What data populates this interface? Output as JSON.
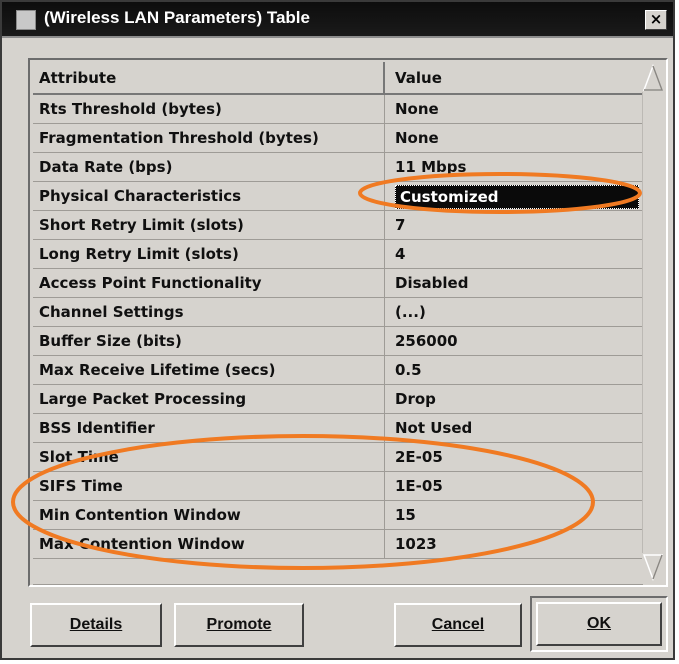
{
  "window": {
    "title": "(Wireless LAN Parameters) Table",
    "close_glyph": "×"
  },
  "table": {
    "columns": [
      "Attribute",
      "Value"
    ],
    "rows": [
      {
        "attribute": "Rts Threshold (bytes)",
        "value": "None"
      },
      {
        "attribute": "Fragmentation Threshold (bytes)",
        "value": "None"
      },
      {
        "attribute": "Data Rate (bps)",
        "value": "11 Mbps"
      },
      {
        "attribute": "Physical Characteristics",
        "value": "Customized",
        "selected": true
      },
      {
        "attribute": "Short Retry Limit (slots)",
        "value": "7"
      },
      {
        "attribute": "Long Retry Limit (slots)",
        "value": "4"
      },
      {
        "attribute": "Access Point Functionality",
        "value": "Disabled"
      },
      {
        "attribute": "Channel Settings",
        "value": "(...)"
      },
      {
        "attribute": "Buffer Size (bits)",
        "value": "256000"
      },
      {
        "attribute": "Max Receive Lifetime (secs)",
        "value": "0.5"
      },
      {
        "attribute": "Large Packet Processing",
        "value": "Drop"
      },
      {
        "attribute": "BSS Identifier",
        "value": "Not Used"
      },
      {
        "attribute": "Slot Time",
        "value": "2E-05"
      },
      {
        "attribute": "SIFS Time",
        "value": "1E-05"
      },
      {
        "attribute": "Min Contention Window",
        "value": "15"
      },
      {
        "attribute": "Max Contention Window",
        "value": "1023"
      }
    ]
  },
  "buttons": {
    "details": {
      "label": "Details"
    },
    "promote": {
      "label": "Promote"
    },
    "cancel": {
      "label": "Cancel"
    },
    "ok": {
      "label": "OK"
    }
  },
  "annotations": {
    "color": "#f07a22",
    "highlights": [
      "Physical Characteristics value",
      "Slot Time to Max Contention Window rows"
    ]
  },
  "colors": {
    "window_bg": "#d6d3ce",
    "titlebar_bg": "#0d0d0d",
    "selection_bg": "#0a0a0a",
    "annotation": "#f07a22"
  }
}
